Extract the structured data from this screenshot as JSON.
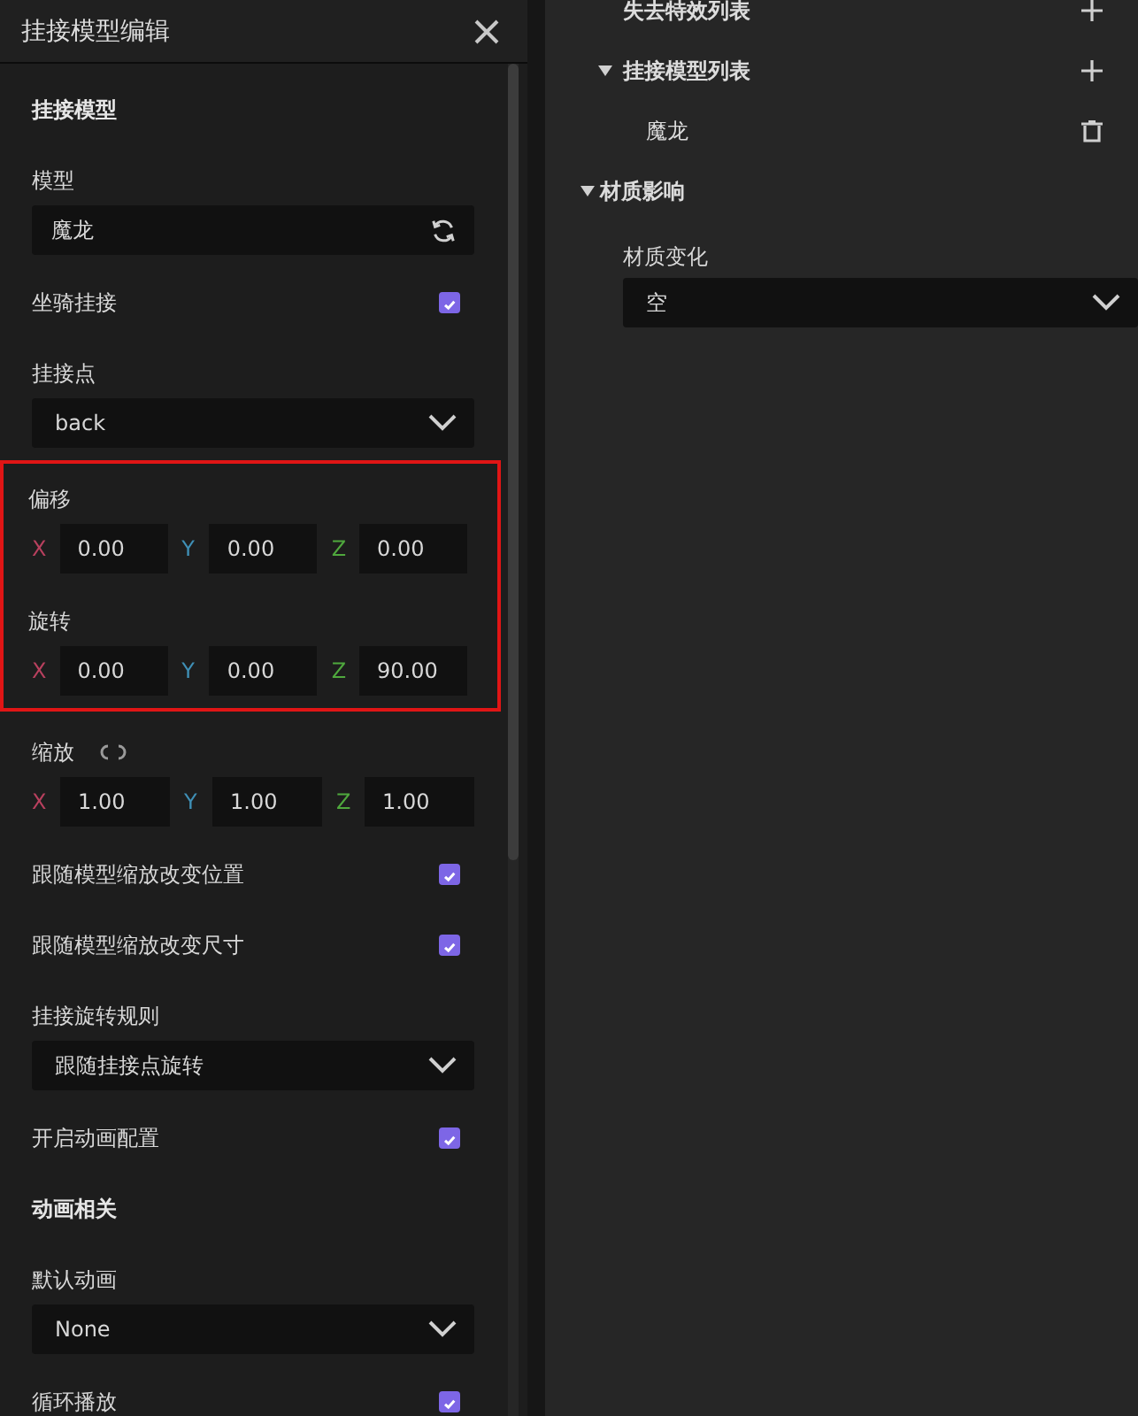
{
  "dialog": {
    "title": "挂接模型编辑",
    "rows": [
      {
        "kind": "section",
        "label": "挂接模型"
      },
      {
        "kind": "label",
        "label": "模型"
      },
      {
        "kind": "field",
        "value": "魔龙"
      },
      {
        "kind": "checkbox",
        "label": "坐骑挂接",
        "checked": true
      },
      {
        "kind": "label",
        "label": "挂接点"
      },
      {
        "kind": "select",
        "value": "back"
      },
      {
        "kind": "highlight",
        "children": [
          {
            "kind": "label",
            "label": "偏移"
          },
          {
            "kind": "vector",
            "axes": [
              {
                "axis": "X",
                "color": "#b8405e",
                "value": "0.00"
              },
              {
                "axis": "Y",
                "color": "#3f8fb5",
                "value": "0.00"
              },
              {
                "axis": "Z",
                "color": "#4fa83d",
                "value": "0.00"
              }
            ]
          },
          {
            "kind": "label",
            "label": "旋转"
          },
          {
            "kind": "vector",
            "axes": [
              {
                "axis": "X",
                "color": "#b8405e",
                "value": "0.00"
              },
              {
                "axis": "Y",
                "color": "#3f8fb5",
                "value": "0.00"
              },
              {
                "axis": "Z",
                "color": "#4fa83d",
                "value": "90.00"
              }
            ]
          }
        ]
      },
      {
        "kind": "link-label",
        "label": "缩放"
      },
      {
        "kind": "vector",
        "axes": [
          {
            "axis": "X",
            "color": "#b8405e",
            "value": "1.00"
          },
          {
            "axis": "Y",
            "color": "#3f8fb5",
            "value": "1.00"
          },
          {
            "axis": "Z",
            "color": "#4fa83d",
            "value": "1.00"
          }
        ]
      },
      {
        "kind": "checkbox",
        "label": "跟随模型缩放改变位置",
        "checked": true
      },
      {
        "kind": "checkbox",
        "label": "跟随模型缩放改变尺寸",
        "checked": true
      },
      {
        "kind": "label",
        "label": "挂接旋转规则"
      },
      {
        "kind": "select",
        "value": "跟随挂接点旋转"
      },
      {
        "kind": "checkbox",
        "label": "开启动画配置",
        "checked": true
      },
      {
        "kind": "section",
        "label": "动画相关"
      },
      {
        "kind": "label",
        "label": "默认动画"
      },
      {
        "kind": "select",
        "value": "None"
      },
      {
        "kind": "checkbox",
        "label": "循环播放",
        "checked": true
      }
    ]
  },
  "properties": {
    "tree": [
      {
        "kind": "list",
        "label": "失去特效列表"
      },
      {
        "kind": "list",
        "label": "挂接模型列表",
        "expanded": true,
        "children": [
          {
            "kind": "entry",
            "label": "魔龙"
          }
        ]
      },
      {
        "kind": "category",
        "label": "材质影响",
        "expanded": true,
        "children": [
          {
            "kind": "select",
            "label": "材质变化",
            "value": "空"
          }
        ]
      }
    ]
  }
}
